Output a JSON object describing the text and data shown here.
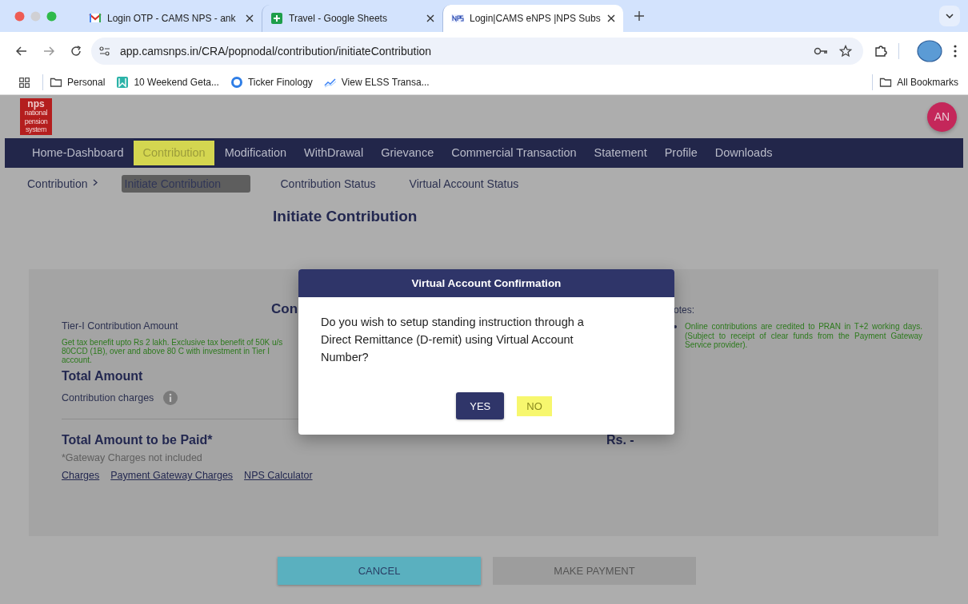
{
  "browser": {
    "tabs": [
      {
        "kind": "mail",
        "title": "Login OTP - CAMS NPS - ank",
        "selected": false
      },
      {
        "kind": "sheets",
        "title": "Travel - Google Sheets",
        "selected": false
      },
      {
        "kind": "nps",
        "title": "Login|CAMS eNPS |NPS Subs",
        "selected": true
      }
    ],
    "address": "app.camsnps.in/CRA/popnodal/contribution/initiateContribution",
    "bookmarks": [
      {
        "kind": "folder",
        "label": "Personal"
      },
      {
        "kind": "bookmark",
        "label": "10 Weekend Geta..."
      },
      {
        "kind": "ring",
        "label": "Ticker Finology"
      },
      {
        "kind": "chart",
        "label": "View ELSS Transa..."
      }
    ],
    "all_bookmarks": "All Bookmarks"
  },
  "header": {
    "logo": {
      "mark": "nps",
      "tagline": [
        "national",
        "pension",
        "system"
      ]
    },
    "avatar": "AN"
  },
  "nav": [
    {
      "label": "Home-Dashboard",
      "selected": false
    },
    {
      "label": "Contribution",
      "selected": true
    },
    {
      "label": "Modification",
      "selected": false
    },
    {
      "label": "WithDrawal",
      "selected": false
    },
    {
      "label": "Grievance",
      "selected": false
    },
    {
      "label": "Commercial Transaction",
      "selected": false
    },
    {
      "label": "Statement",
      "selected": false
    },
    {
      "label": "Profile",
      "selected": false
    },
    {
      "label": "Downloads",
      "selected": false
    }
  ],
  "subnav": {
    "breadcrumb": "Contribution",
    "items": [
      {
        "label": "Initiate Contribution",
        "selected": true
      },
      {
        "label": "Contribution Status",
        "selected": false
      },
      {
        "label": "Virtual Account Status",
        "selected": false
      }
    ]
  },
  "page_title": "Initiate Contribution",
  "card": {
    "heading": "Con",
    "notes_label": "otes:",
    "tier_label": "Tier-I Contribution Amount",
    "tax_note": "Get tax benefit upto Rs 2 lakh. Exclusive tax benefit of 50K u/s 80CCD (1B), over and above 80 C with investment in Tier I account.",
    "notes": [
      "Online contributions are credited to PRAN in T+2 working days. (Subject to receipt of clear funds from the Payment Gateway Service provider)."
    ],
    "total_amount": "Total Amount",
    "charges_label": "Contribution charges",
    "total_paid": "Total Amount to be Paid*",
    "total_value": "Rs. -",
    "gateway_note": "*Gateway Charges not included",
    "links": [
      "Charges",
      "Payment Gateway Charges",
      "NPS Calculator"
    ]
  },
  "actions": [
    {
      "label": "CANCEL",
      "disabled": false
    },
    {
      "label": "MAKE PAYMENT",
      "disabled": true
    }
  ],
  "dialog": {
    "title": "Virtual Account Confirmation",
    "message": "Do you wish to setup standing instruction through a Direct Remittance (D-remit) using Virtual Account Number?",
    "buttons": [
      {
        "label": "YES",
        "highlighted": false
      },
      {
        "label": "NO",
        "highlighted": true
      }
    ]
  }
}
